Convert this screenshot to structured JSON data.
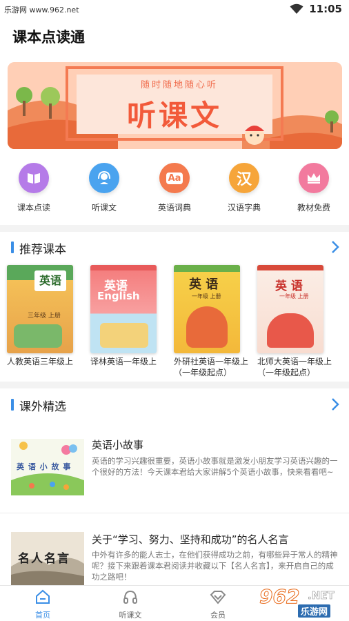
{
  "status": {
    "site": "乐游网 www.962.net",
    "time": "11:05"
  },
  "app": {
    "title": "课本点读通"
  },
  "banner": {
    "subtitle": "随时随地随心听",
    "title": "听课文"
  },
  "quick_nav": [
    {
      "label": "课本点读",
      "icon": "book-open-icon",
      "color": "#b57be8"
    },
    {
      "label": "听课文",
      "icon": "headset-icon",
      "color": "#4aa3ef"
    },
    {
      "label": "英语词典",
      "icon": "aa-dictionary-icon",
      "glyph": "Aa",
      "color": "#f47a4e"
    },
    {
      "label": "汉语字典",
      "icon": "han-character-icon",
      "glyph": "汉",
      "color": "#f6a53a"
    },
    {
      "label": "教材免费",
      "icon": "crown-icon",
      "color": "#f27a9e"
    }
  ],
  "recommended": {
    "title": "推荐课本",
    "books": [
      {
        "name": "人教英语三年级上",
        "cover_title": "英语",
        "cover_sub": "三年级 上册"
      },
      {
        "name": "译林英语一年级上",
        "cover_title": "英语",
        "cover_sub": "English"
      },
      {
        "name": "外研社英语一年级上（一年级起点）",
        "cover_title": "英 语",
        "cover_sub": "一年级 上册"
      },
      {
        "name": "北师大英语一年级上（一年级起点）",
        "cover_title": "英 语",
        "cover_sub": "一年级 上册"
      }
    ]
  },
  "extracurricular": {
    "title": "课外精选",
    "articles": [
      {
        "title": "英语小故事",
        "desc": "英语的学习兴趣很重要，英语小故事就是激发小朋友学习英语兴趣的一个很好的方法！今天课本君给大家讲解5个英语小故事，快来看看吧~",
        "thumb_text": "英 语 小 故 事"
      },
      {
        "title": "关于“学习、努力、坚持和成功”的名人名言",
        "desc": "中外有许多的能人志士，在他们获得成功之前，有哪些异于常人的精神呢？接下来跟着课本君阅读并收藏以下【名人名言】，来开启自己的成功之路吧！",
        "thumb_text": "名人名言"
      }
    ]
  },
  "tabs": [
    {
      "label": "首页",
      "icon": "home-icon",
      "active": true
    },
    {
      "label": "听课文",
      "icon": "headphones-icon",
      "active": false
    },
    {
      "label": "会员",
      "icon": "diamond-icon",
      "active": false
    }
  ],
  "watermark": {
    "num": "962",
    "net": ".NET",
    "site": "乐游网"
  },
  "colors": {
    "accent": "#3a8ee6",
    "banner_text": "#f25a3a"
  }
}
